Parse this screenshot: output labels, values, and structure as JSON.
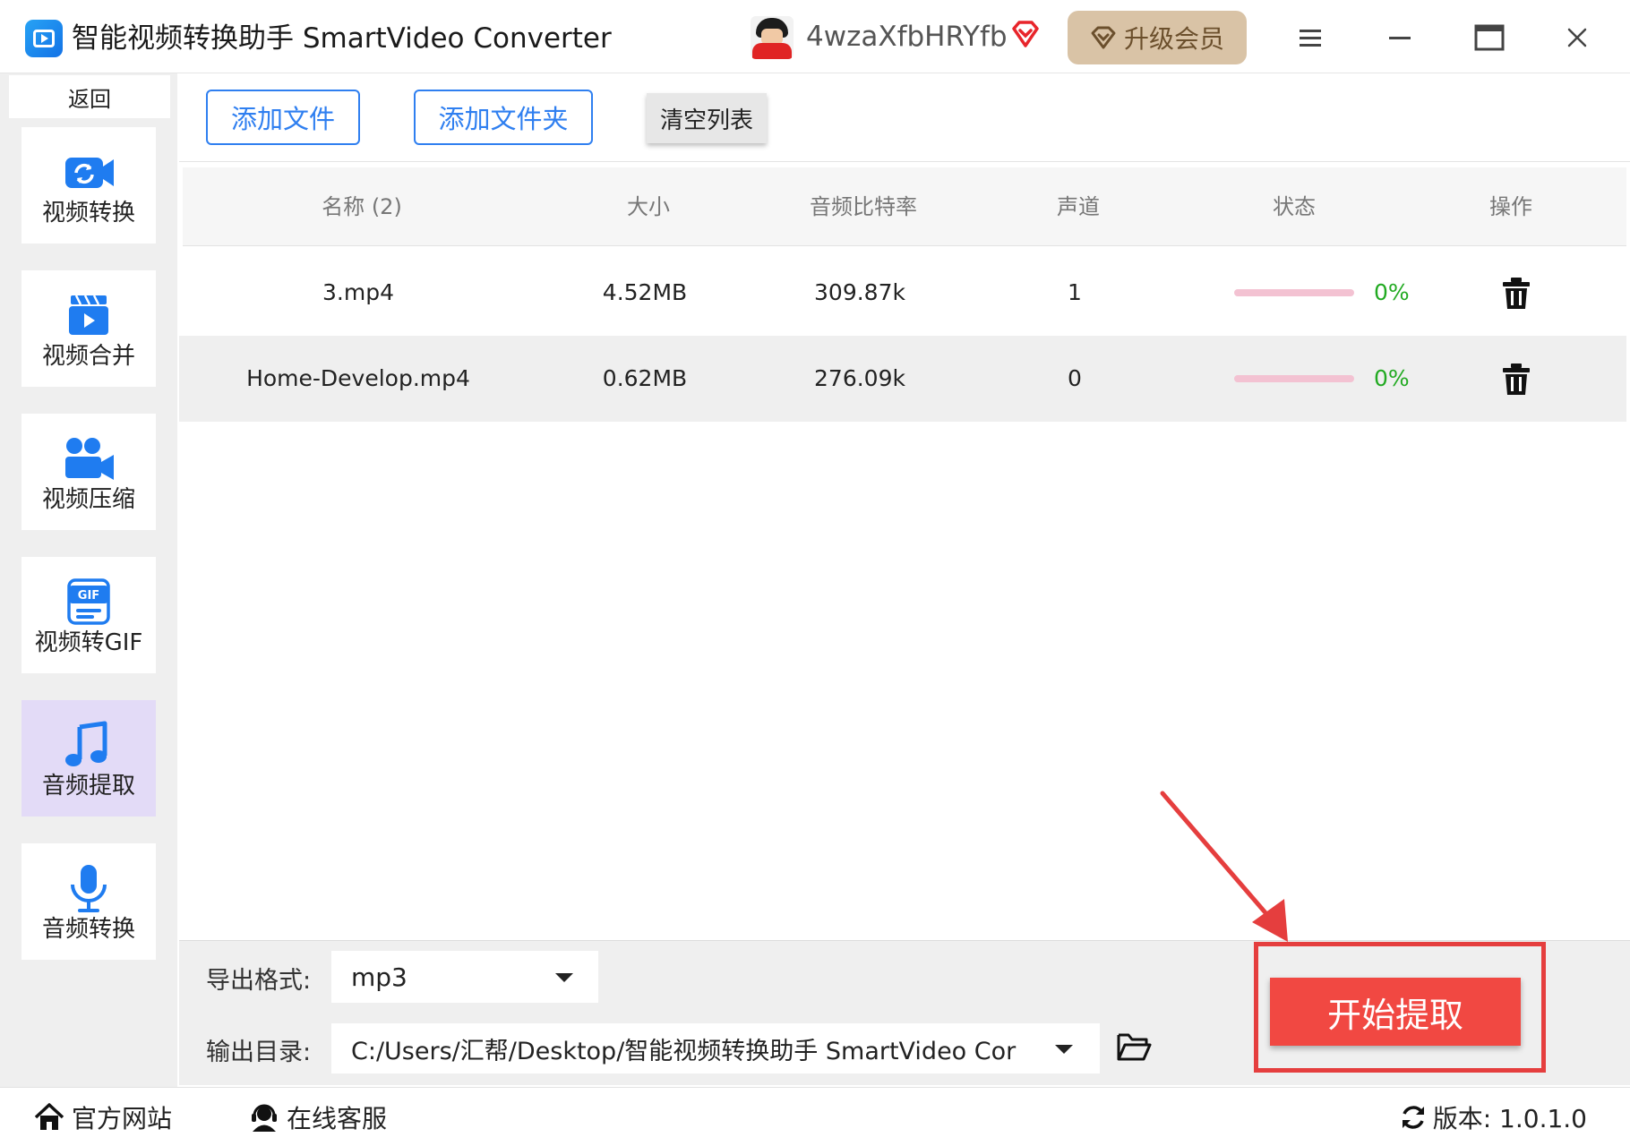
{
  "app": {
    "title": "智能视频转换助手 SmartVideo Converter"
  },
  "user": {
    "name": "4wzaXfbHRYfb",
    "upgrade_label": "升级会员"
  },
  "sidebar": {
    "back_label": "返回",
    "items": [
      {
        "label": "视频转换",
        "icon": "video-convert-icon"
      },
      {
        "label": "视频合并",
        "icon": "video-merge-icon"
      },
      {
        "label": "视频压缩",
        "icon": "video-compress-icon"
      },
      {
        "label": "视频转GIF",
        "icon": "gif-icon"
      },
      {
        "label": "音频提取",
        "icon": "music-note-icon",
        "active": true
      },
      {
        "label": "音频转换",
        "icon": "microphone-icon"
      }
    ]
  },
  "toolbar": {
    "add_file_label": "添加文件",
    "add_folder_label": "添加文件夹",
    "clear_label": "清空列表"
  },
  "table": {
    "headers": [
      "名称 (2)",
      "大小",
      "音频比特率",
      "声道",
      "状态",
      "操作"
    ],
    "rows": [
      {
        "name": "3.mp4",
        "size": "4.52MB",
        "bitrate": "309.87k",
        "channels": "1",
        "progress_percent": 0,
        "status": "0%"
      },
      {
        "name": "Home-Develop.mp4",
        "size": "0.62MB",
        "bitrate": "276.09k",
        "channels": "0",
        "progress_percent": 0,
        "status": "0%"
      }
    ]
  },
  "output": {
    "format_label": "导出格式:",
    "format_value": "mp3",
    "dir_label": "输出目录:",
    "dir_value": "C:/Users/汇帮/Desktop/智能视频转换助手 SmartVideo Cor"
  },
  "actions": {
    "start_label": "开始提取"
  },
  "statusbar": {
    "website_label": "官方网站",
    "support_label": "在线客服",
    "version_text": "版本: 1.0.1.0"
  },
  "colors": {
    "accent_blue": "#2f7ff0",
    "start_red": "#f14842",
    "highlight_red": "#e53e3e",
    "progress_track": "#f3c2d2",
    "status_green": "#22aa22",
    "active_item_bg": "#e3dbf7",
    "upgrade_bg": "#d9c3a6"
  }
}
